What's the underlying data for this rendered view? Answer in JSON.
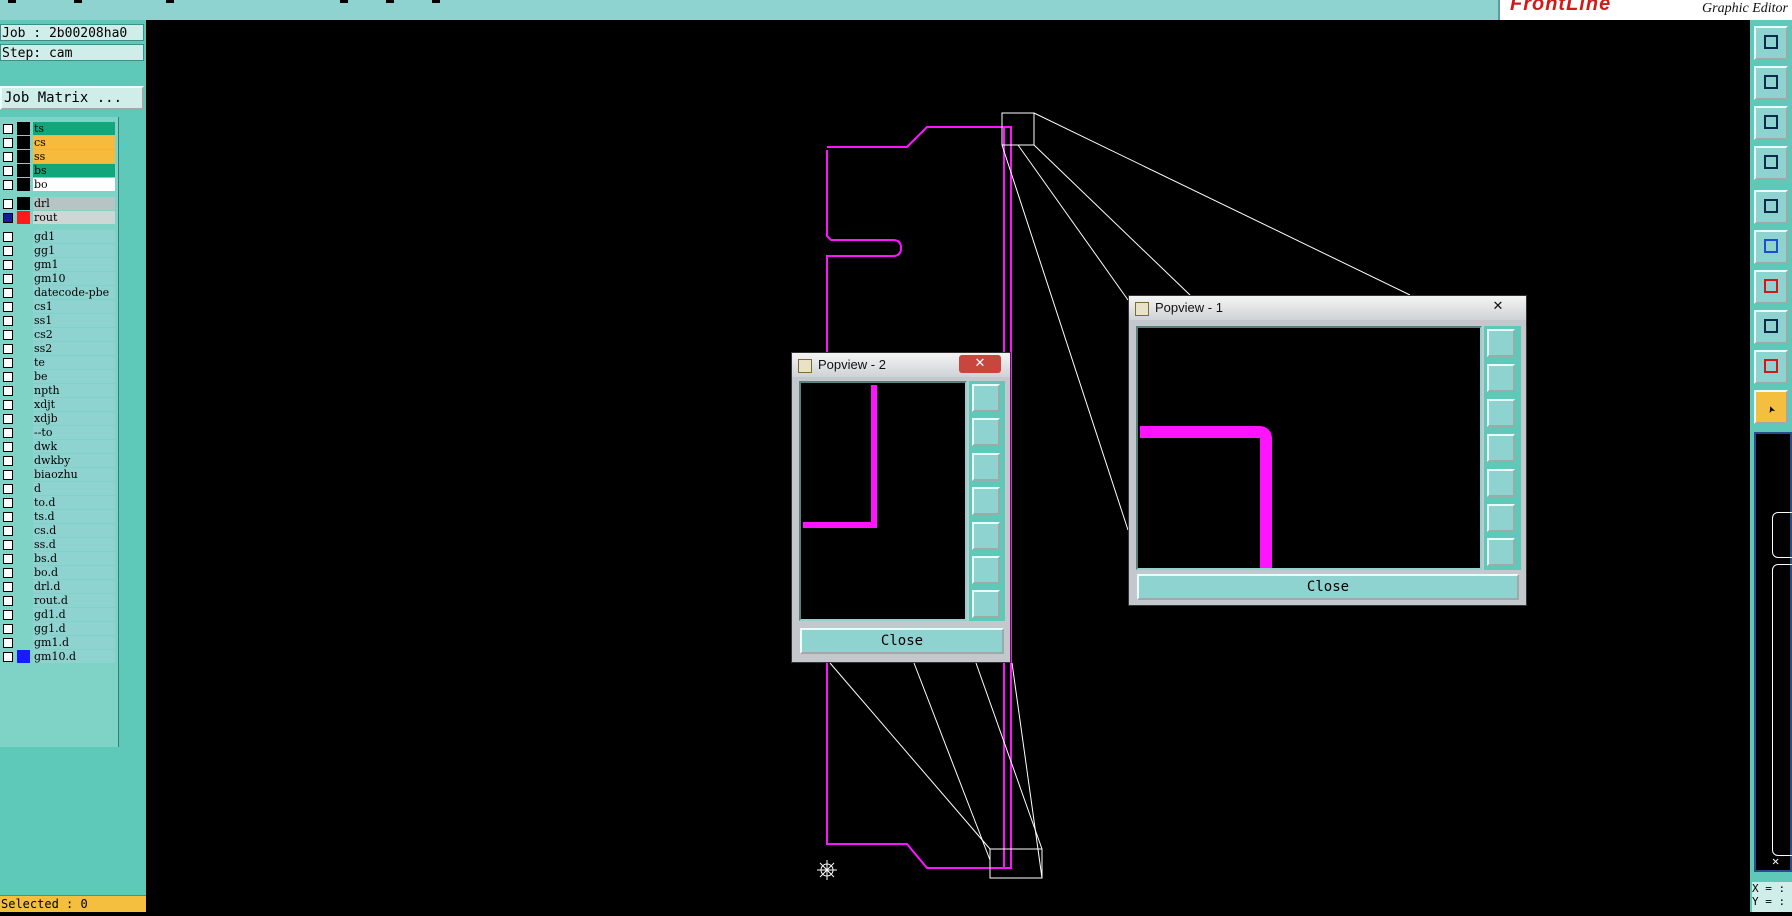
{
  "app": {
    "brand_logo": "FrontLine",
    "brand_subtitle": "Graphic Editor"
  },
  "job": {
    "job_label": "Job : 2b00208ha0",
    "step_label": "Step: cam",
    "matrix_button": "Job Matrix ..."
  },
  "layers": [
    {
      "name": "ts",
      "color": "#12a77a"
    },
    {
      "name": "cs",
      "color": "#f6bb3c"
    },
    {
      "name": "ss",
      "color": "#f6bb3c"
    },
    {
      "name": "bs",
      "color": "#12a77a"
    },
    {
      "name": "bo",
      "color": "#ffffff"
    },
    {
      "name": "drl",
      "color": "#b7c4c4"
    },
    {
      "name": "rout",
      "color": "#cfd6d6",
      "active": true
    },
    {
      "name": "gd1",
      "color": "#8fd3d0"
    },
    {
      "name": "gg1",
      "color": "#8fd3d0"
    },
    {
      "name": "gm1",
      "color": "#8fd3d0"
    },
    {
      "name": "gm10",
      "color": "#8fd3d0"
    },
    {
      "name": "datecode-pbe",
      "color": "#8fd3d0"
    },
    {
      "name": "cs1",
      "color": "#8fd3d0"
    },
    {
      "name": "ss1",
      "color": "#8fd3d0"
    },
    {
      "name": "cs2",
      "color": "#8fd3d0"
    },
    {
      "name": "ss2",
      "color": "#8fd3d0"
    },
    {
      "name": "te",
      "color": "#8fd3d0"
    },
    {
      "name": "be",
      "color": "#8fd3d0"
    },
    {
      "name": "npth",
      "color": "#8fd3d0"
    },
    {
      "name": "xdjt",
      "color": "#8fd3d0"
    },
    {
      "name": "xdjb",
      "color": "#8fd3d0"
    },
    {
      "name": "--to",
      "color": "#8fd3d0"
    },
    {
      "name": "dwk",
      "color": "#8fd3d0"
    },
    {
      "name": "dwkby",
      "color": "#8fd3d0"
    },
    {
      "name": "biaozhu",
      "color": "#8fd3d0"
    },
    {
      "name": "d",
      "color": "#8fd3d0"
    },
    {
      "name": "to.d",
      "color": "#8fd3d0"
    },
    {
      "name": "ts.d",
      "color": "#8fd3d0"
    },
    {
      "name": "cs.d",
      "color": "#8fd3d0"
    },
    {
      "name": "ss.d",
      "color": "#8fd3d0"
    },
    {
      "name": "bs.d",
      "color": "#8fd3d0"
    },
    {
      "name": "bo.d",
      "color": "#8fd3d0"
    },
    {
      "name": "drl.d",
      "color": "#8fd3d0"
    },
    {
      "name": "rout.d",
      "color": "#8fd3d0"
    },
    {
      "name": "gd1.d",
      "color": "#8fd3d0"
    },
    {
      "name": "gg1.d",
      "color": "#8fd3d0"
    },
    {
      "name": "gm1.d",
      "color": "#8fd3d0"
    },
    {
      "name": "gm10.d",
      "color": "#8fd3d0"
    }
  ],
  "status": {
    "selected": "Selected : 0",
    "coord_x": "X = :",
    "coord_y": "Y = :"
  },
  "popview1": {
    "title": "Popview - 1",
    "close_label": "Close"
  },
  "popview2": {
    "title": "Popview - 2",
    "close_label": "Close"
  },
  "colors": {
    "rout_line": "#ff14ff",
    "panel_teal": "#5fc9b9",
    "button_teal": "#8fd3d0",
    "highlight_orange": "#f4bf3e",
    "close_red": "#c9463e"
  },
  "toolbar_icons": [
    "home-icon",
    "zoom-in-icon",
    "fit-screen-icon",
    "settings-tools-icon",
    "snapshot-icon",
    "graph-nodes-icon",
    "measure-icon",
    "transform-icon",
    "triangle-icon",
    "pointer-icon"
  ]
}
